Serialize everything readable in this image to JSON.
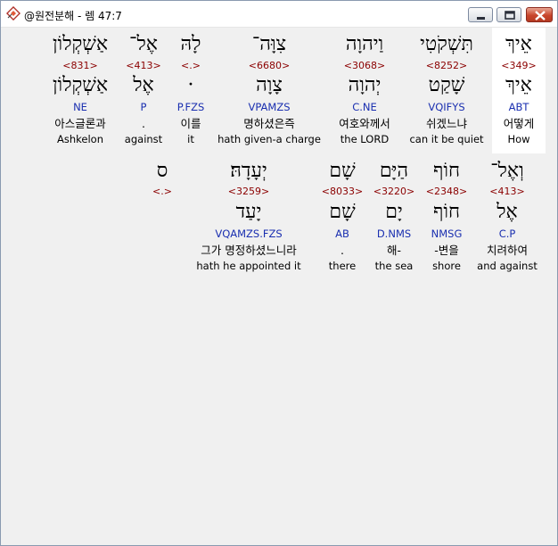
{
  "window": {
    "title": "@원전분해 - 렘 47:7",
    "icon": "app-diamond-icon",
    "controls": [
      "minimize-icon",
      "maximize-icon",
      "close-icon"
    ]
  },
  "colors": {
    "strong": "#8b0000",
    "morph": "#1a2fb0",
    "highlight": "#ffffff",
    "background": "#f0f0f0"
  },
  "row1": [
    {
      "heb": "אֵיךְ",
      "strong": "<349>",
      "lex": "אֵיךְ",
      "morph": "ABT",
      "kor": "어떻게",
      "eng": "How"
    },
    {
      "heb": "תִּשְׁקֹטִי",
      "strong": "<8252>",
      "lex": "שָׁקַט",
      "morph": "VQIFYS",
      "kor": "쉬겠느냐",
      "eng": "can it be quiet"
    },
    {
      "heb": "וַיהוָה",
      "strong": "<3068>",
      "lex": "יְהוָה",
      "morph": "C.NE",
      "kor": "여호와께서",
      "eng": "the LORD"
    },
    {
      "heb": "צִוָּה־",
      "strong": "<6680>",
      "lex": "צָוָה",
      "morph": "VPAMZS",
      "kor": "명하셨은즉",
      "eng": "hath given-a charge"
    },
    {
      "heb": "לָהּ",
      "strong": "<.>",
      "lex": "·",
      "morph": "P.FZS",
      "kor": "이를",
      "eng": "it"
    },
    {
      "heb": "אֶל־",
      "strong": "<413>",
      "lex": "אֶל",
      "morph": "P",
      "kor": ".",
      "eng": "against"
    },
    {
      "heb": "אַשְׁקְלוֹן",
      "strong": "<831>",
      "lex": "אַשְׁקְלוֹן",
      "morph": "NE",
      "kor": "아스글론과",
      "eng": "Ashkelon"
    }
  ],
  "row2": [
    {
      "heb": "וְאֶל־",
      "strong": "<413>",
      "lex": "אֶל",
      "morph": "C.P",
      "kor": "치려하여",
      "eng": "and against"
    },
    {
      "heb": "חוֹף",
      "strong": "<2348>",
      "lex": "חוֹף",
      "morph": "NMSG",
      "kor": "-변을",
      "eng": "shore"
    },
    {
      "heb": "הַיָּם",
      "strong": "<3220>",
      "lex": "יָם",
      "morph": "D.NMS",
      "kor": "해-",
      "eng": "the sea"
    },
    {
      "heb": "שָׁם",
      "strong": "<8033>",
      "lex": "שָׁם",
      "morph": "AB",
      "kor": ".",
      "eng": "there"
    },
    {
      "heb": "יְעָדָהּ׃",
      "strong": "<3259>",
      "lex": "יָעַד",
      "morph": "VQAMZS.FZS",
      "kor": "그가 명정하셨느니라",
      "eng": "hath he appointed it"
    },
    {
      "heb": "ס",
      "strong": "<.>",
      "lex": "",
      "morph": "",
      "kor": "",
      "eng": ""
    }
  ]
}
